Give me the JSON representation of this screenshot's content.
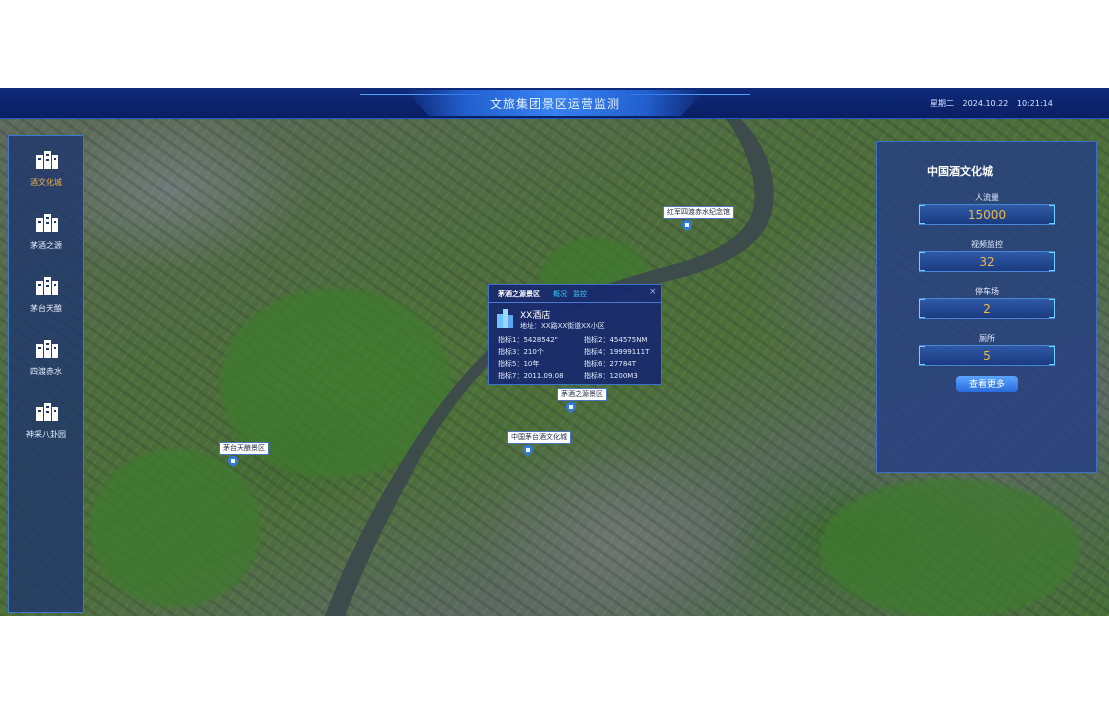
{
  "header": {
    "title": "文旅集团景区运营监测",
    "weekday": "星期二",
    "date": "2024.10.22",
    "time": "10:21:14"
  },
  "sidebar": {
    "items": [
      {
        "label": "酒文化城",
        "active": true
      },
      {
        "label": "茅酒之源",
        "active": false
      },
      {
        "label": "茅台天酿",
        "active": false
      },
      {
        "label": "四渡赤水",
        "active": false
      },
      {
        "label": "神采八卦园",
        "active": false
      }
    ]
  },
  "panel": {
    "title": "中国酒文化城",
    "stats": [
      {
        "label": "人流量",
        "value": "15000"
      },
      {
        "label": "视频监控",
        "value": "32"
      },
      {
        "label": "停车场",
        "value": "2"
      },
      {
        "label": "厕所",
        "value": "5"
      }
    ],
    "more_label": "查看更多"
  },
  "markers": [
    {
      "label": "红军四渡赤水纪念馆"
    },
    {
      "label": "茅酒之源景区"
    },
    {
      "label": "中国茅台酒文化城"
    },
    {
      "label": "茅台天酿景区"
    }
  ],
  "popup": {
    "title": "茅酒之源景区",
    "tabs": [
      "概况",
      "监控"
    ],
    "close": "×",
    "name": "XX酒店",
    "address": "地址：XX路XX街道XX小区",
    "metrics": [
      {
        "label": "指标1：",
        "value": "5428542\""
      },
      {
        "label": "指标2：",
        "value": "454575NM"
      },
      {
        "label": "指标3：",
        "value": "210个"
      },
      {
        "label": "指标4：",
        "value": "19999111T"
      },
      {
        "label": "指标5：",
        "value": "10年"
      },
      {
        "label": "指标6：",
        "value": "27784T"
      },
      {
        "label": "指标7：",
        "value": "2011.09.08"
      },
      {
        "label": "指标8：",
        "value": "1200M3"
      }
    ]
  },
  "colors": {
    "header_bg": "#0a1f63",
    "accent": "#3a78d6",
    "active_text": "#f0b24a",
    "stat_value": "#f3b84a",
    "button": "#2a6bdc"
  },
  "icons": {
    "nav": "building-icon",
    "marker": "location-pin-icon",
    "popup": "building-icon",
    "close": "close-icon"
  }
}
